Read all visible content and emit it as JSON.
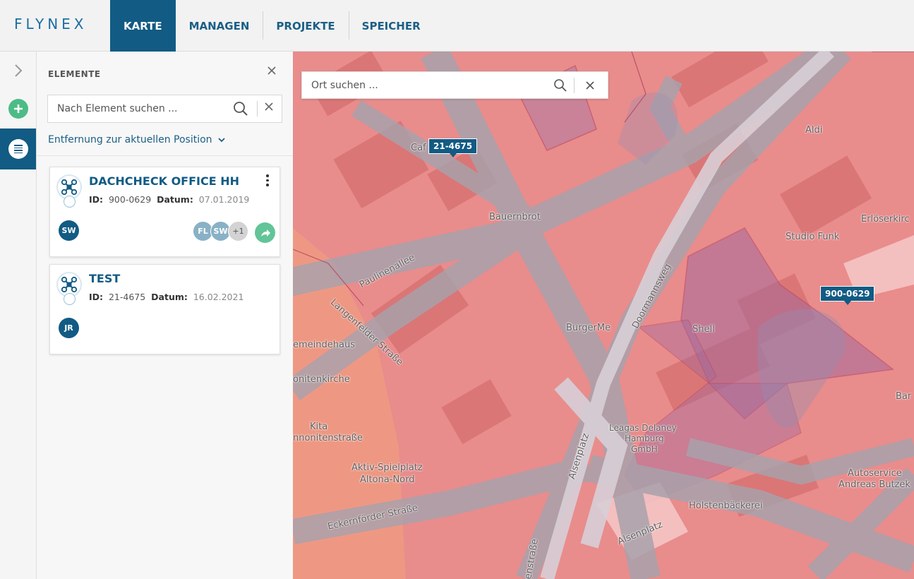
{
  "app": {
    "logo": "FLYNEX",
    "nav": [
      {
        "label": "KARTE",
        "active": true
      },
      {
        "label": "MANAGEN",
        "active": false
      },
      {
        "label": "PROJEKTE",
        "active": false
      },
      {
        "label": "SPEICHER",
        "active": false
      }
    ]
  },
  "rail": {
    "icons": [
      "chevron-right-icon",
      "plus-icon",
      "list-icon"
    ]
  },
  "panel": {
    "title": "ELEMENTE",
    "search_placeholder": "Nach Element suchen ...",
    "distance_label": "Entfernung zur aktuellen Position",
    "cards": [
      {
        "title": "DACHCHECK OFFICE HH",
        "id_label": "ID:",
        "id": "900-0629",
        "date_label": "Datum:",
        "date": "07.01.2019",
        "owner": "SW",
        "members": [
          "FL",
          "SW"
        ],
        "more": "+1"
      },
      {
        "title": "TEST",
        "id_label": "ID:",
        "id": "21-4675",
        "date_label": "Datum:",
        "date": "16.02.2021",
        "owner": "JR"
      }
    ]
  },
  "map": {
    "search_placeholder": "Ort suchen ...",
    "markers": [
      "21-4675",
      "900-0629"
    ],
    "labels": {
      "aldi": "Aldi",
      "cafe": "Caf",
      "bauernbrot": "Bauernbrot",
      "erloeser": "Erlöserkirc",
      "studio": "Studio Funk",
      "pauline": "Paulinenallee",
      "doormann": "Doormannsweg",
      "burgerme": "BurgerMe",
      "shell": "Shell",
      "langenfelder": "Langenfelder Straße",
      "gemeinde": "emeindehaus",
      "kirche": "onitenkirche",
      "kita1": "Kita",
      "kita2": "nnonitenstraße",
      "bar": "Bar",
      "leagas1": "Leagas Delaney",
      "leagas2": "Hamburg",
      "leagas3": "GmbH",
      "alsen1": "Alsenplatz",
      "alsen2": "Alsenplatz",
      "spiel1": "Aktiv-Spielplatz",
      "spiel2": "Altona-Nord",
      "auto1": "Autoservice",
      "auto2": "Andreas Butzek",
      "eckern": "Eckernförder Straße",
      "holsten": "Holstenbäckerei",
      "strasse": "enstraße"
    }
  },
  "colors": {
    "brand": "#115b84",
    "accent_green": "#4cbc86",
    "map_zone": "#e98c8c"
  }
}
